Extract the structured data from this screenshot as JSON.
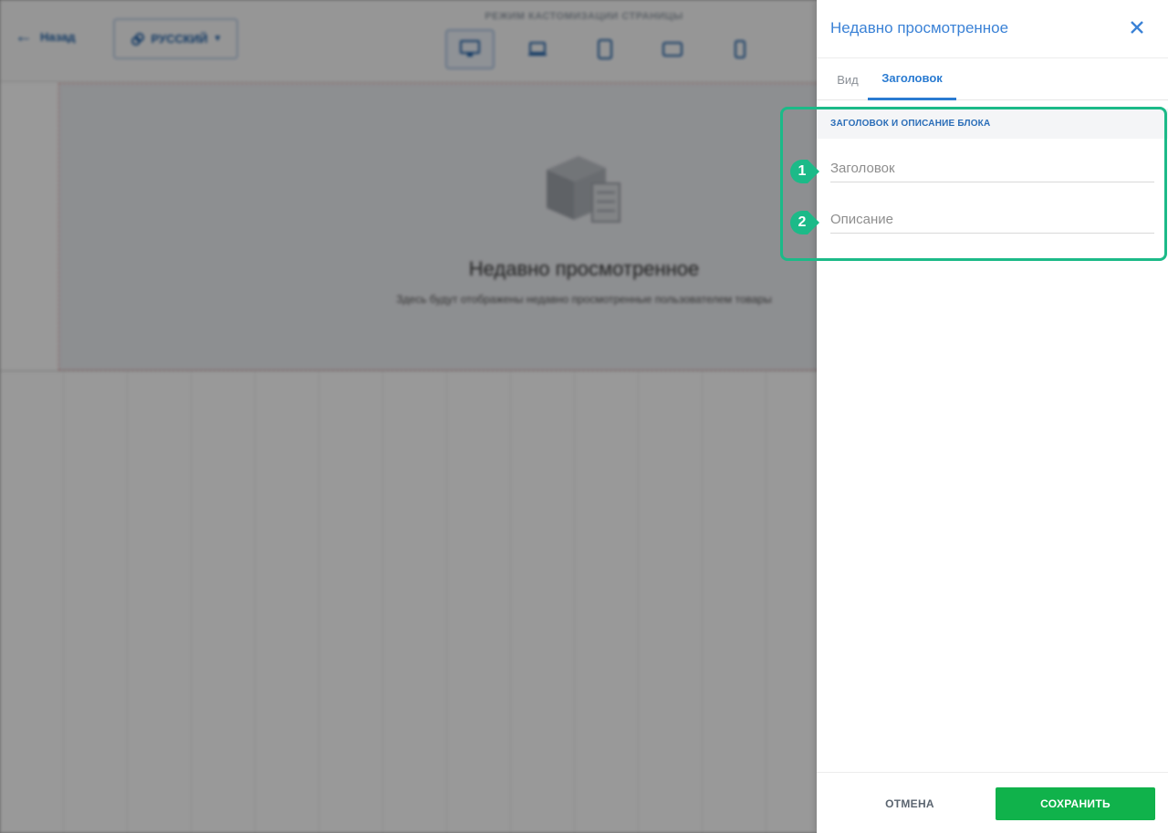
{
  "editor": {
    "back_label": "Назад",
    "language_label": "РУССКИЙ",
    "mode_label": "РЕЖИМ КАСТОМИЗАЦИИ СТРАНИЦЫ",
    "block": {
      "title": "Недавно просмотренное",
      "subtitle": "Здесь будут отображены недавно просмотренные пользователем товары"
    }
  },
  "panel": {
    "title": "Недавно просмотренное",
    "tabs": [
      {
        "label": "Вид"
      },
      {
        "label": "Заголовок"
      }
    ],
    "section_title": "ЗАГОЛОВОК И ОПИСАНИЕ БЛОКА",
    "fields": {
      "title_placeholder": "Заголовок",
      "description_placeholder": "Описание"
    },
    "cancel_label": "ОТМЕНА",
    "save_label": "СОХРАНИТЬ"
  },
  "annotations": {
    "marker1": "1",
    "marker2": "2"
  },
  "colors": {
    "accent": "#2a7bd1",
    "save": "#10b24b",
    "highlight": "#1cba88"
  }
}
